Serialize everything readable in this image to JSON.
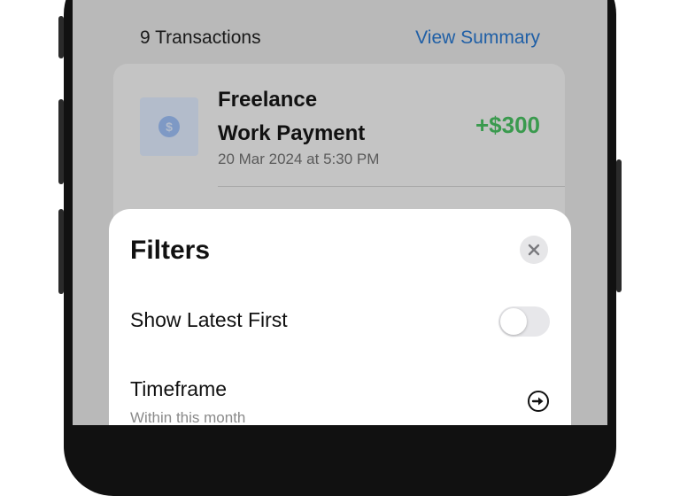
{
  "colors": {
    "accent_blue": "#1f5fa6",
    "amount_green": "#3a9a4e",
    "overlay_gray": "#b9b9b9",
    "sheet_bg": "#ffffff"
  },
  "transactions": {
    "count_label": "9 Transactions",
    "view_summary_label": "View Summary",
    "items": [
      {
        "icon": "dollar-icon",
        "title_line1": "Freelance",
        "title_line2": "Work Payment",
        "date": "20 Mar 2024 at 5:30 PM",
        "amount": "+$300"
      }
    ]
  },
  "filters": {
    "title": "Filters",
    "close_icon": "close-icon",
    "show_latest_label": "Show Latest First",
    "show_latest_value": false,
    "timeframe_label": "Timeframe",
    "timeframe_value": "Within this month",
    "timeframe_icon": "arrow-right-circle-icon"
  }
}
